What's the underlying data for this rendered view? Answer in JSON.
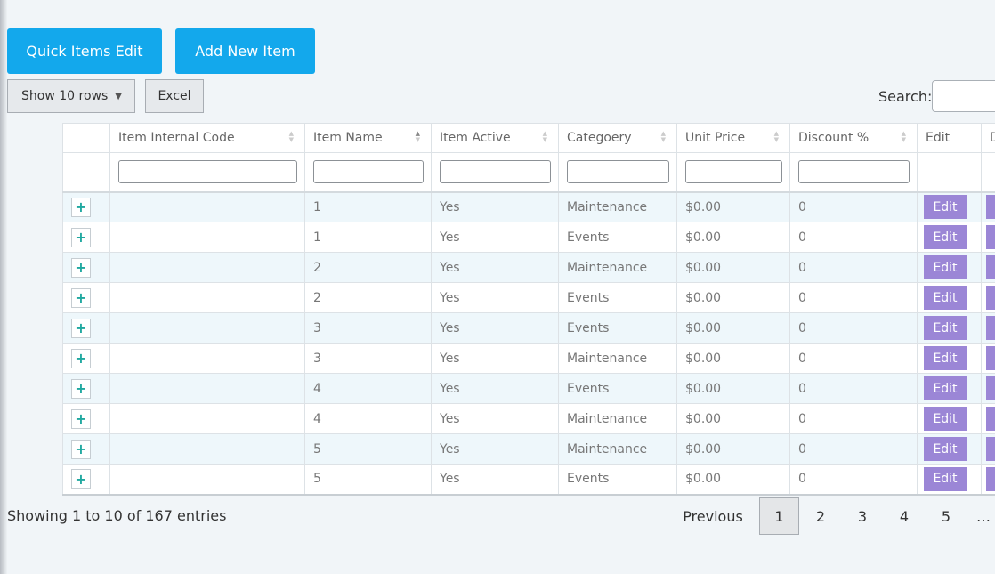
{
  "toolbar": {
    "quick_edit_label": "Quick Items Edit",
    "add_item_label": "Add New Item",
    "show_rows_label": "Show 10 rows",
    "excel_label": "Excel",
    "search_label": "Search:",
    "search_value": ""
  },
  "table": {
    "columns": [
      "",
      "Item Internal Code",
      "Item Name",
      "Item Active",
      "Categoery",
      "Unit Price",
      "Discount %",
      "Edit",
      "D"
    ],
    "filter_placeholder": "...",
    "edit_label": "Edit",
    "rows": [
      {
        "code": "",
        "name": "1",
        "active": "Yes",
        "category": "Maintenance",
        "price": "$0.00",
        "discount": "0"
      },
      {
        "code": "",
        "name": "1",
        "active": "Yes",
        "category": "Events",
        "price": "$0.00",
        "discount": "0"
      },
      {
        "code": "",
        "name": "2",
        "active": "Yes",
        "category": "Maintenance",
        "price": "$0.00",
        "discount": "0"
      },
      {
        "code": "",
        "name": "2",
        "active": "Yes",
        "category": "Events",
        "price": "$0.00",
        "discount": "0"
      },
      {
        "code": "",
        "name": "3",
        "active": "Yes",
        "category": "Events",
        "price": "$0.00",
        "discount": "0"
      },
      {
        "code": "",
        "name": "3",
        "active": "Yes",
        "category": "Maintenance",
        "price": "$0.00",
        "discount": "0"
      },
      {
        "code": "",
        "name": "4",
        "active": "Yes",
        "category": "Events",
        "price": "$0.00",
        "discount": "0"
      },
      {
        "code": "",
        "name": "4",
        "active": "Yes",
        "category": "Maintenance",
        "price": "$0.00",
        "discount": "0"
      },
      {
        "code": "",
        "name": "5",
        "active": "Yes",
        "category": "Maintenance",
        "price": "$0.00",
        "discount": "0"
      },
      {
        "code": "",
        "name": "5",
        "active": "Yes",
        "category": "Events",
        "price": "$0.00",
        "discount": "0"
      }
    ]
  },
  "footer": {
    "info": "Showing 1 to 10 of 167 entries",
    "previous": "Previous",
    "pages": [
      "1",
      "2",
      "3",
      "4",
      "5"
    ],
    "ellipsis": "…",
    "current_page": "1"
  },
  "colors": {
    "primary": "#13a8ec",
    "edit": "#9b86d6",
    "row_stripe": "#eef7fb",
    "background": "#f1f5f8"
  },
  "icons": {
    "expand": "plus-icon",
    "sort": "sort-icon",
    "caret": "caret-down-icon"
  }
}
